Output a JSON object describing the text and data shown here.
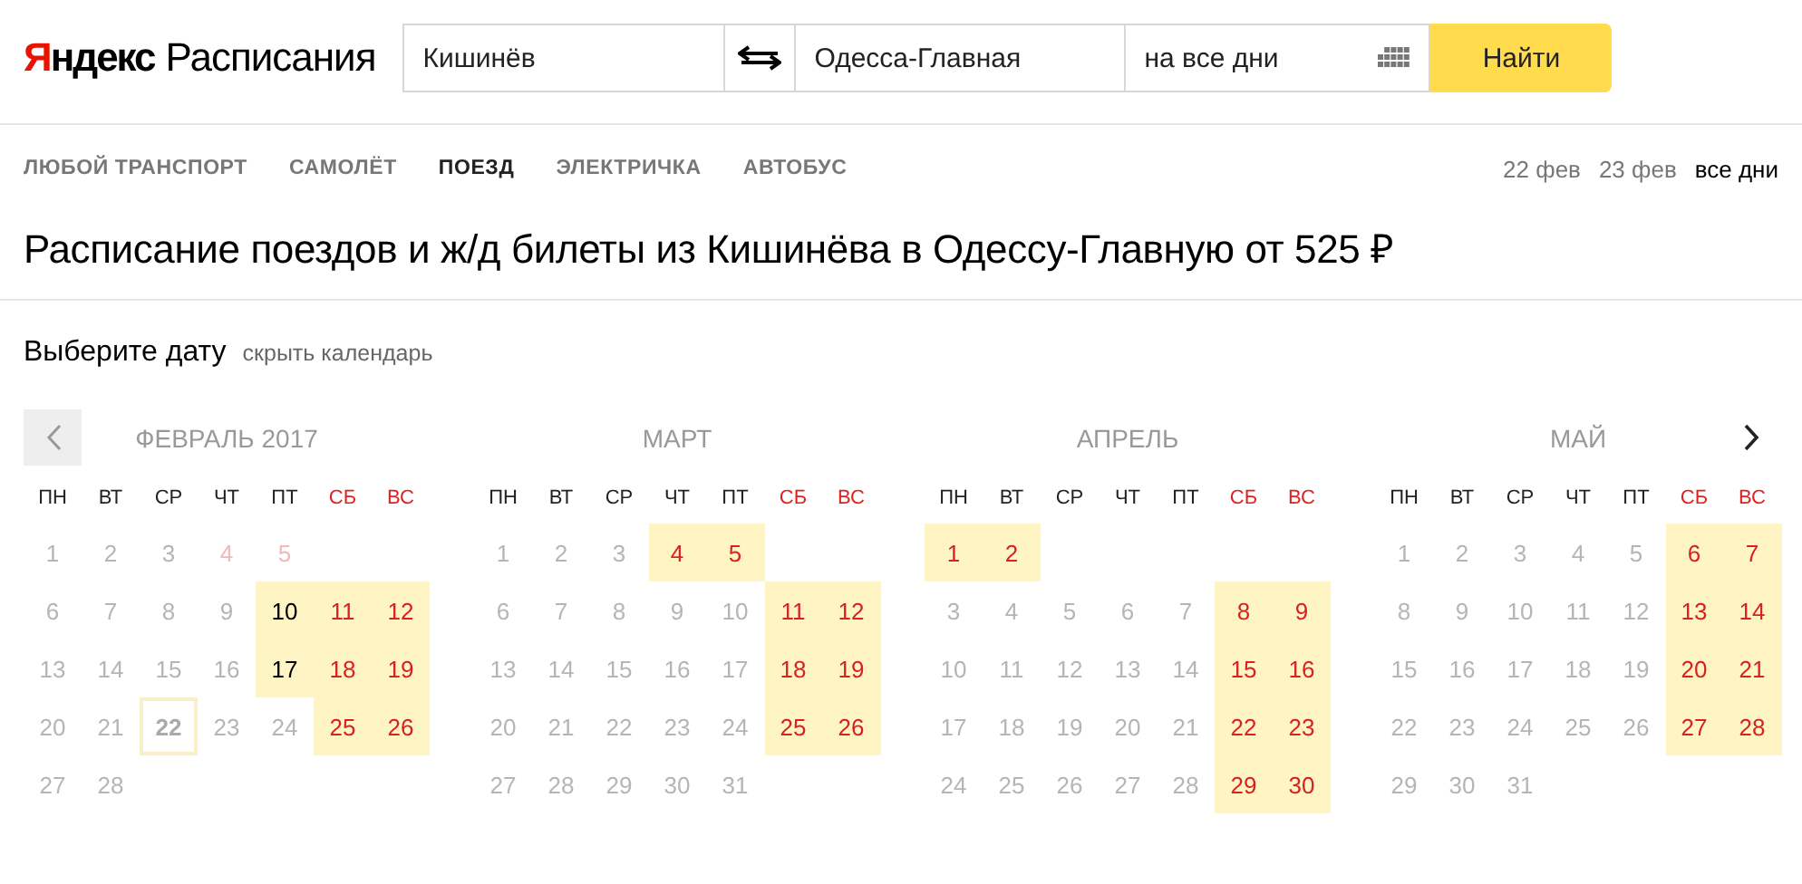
{
  "logo": {
    "brand": "Яндекс",
    "product": "Расписания"
  },
  "search": {
    "from": "Кишинёв",
    "to": "Одесса-Главная",
    "date": "на все дни",
    "submit": "Найти"
  },
  "transport_tabs": [
    {
      "label": "ЛЮБОЙ ТРАНСПОРТ",
      "selected": false
    },
    {
      "label": "САМОЛЁТ",
      "selected": false
    },
    {
      "label": "ПОЕЗД",
      "selected": true
    },
    {
      "label": "ЭЛЕКТРИЧКА",
      "selected": false
    },
    {
      "label": "АВТОБУС",
      "selected": false
    }
  ],
  "date_links": [
    {
      "label": "22 фев",
      "selected": false
    },
    {
      "label": "23 фев",
      "selected": false
    },
    {
      "label": "все дни",
      "selected": true
    }
  ],
  "heading": "Расписание поездов и ж/д билеты из Кишинёва в Одессу-Главную от 525 ₽",
  "calendar": {
    "title": "Выберите дату",
    "hide_link": "скрыть календарь",
    "months": [
      {
        "title": "ФЕВРАЛЬ 2017",
        "weekdays": [
          {
            "label": "ПН",
            "weekend": false
          },
          {
            "label": "ВТ",
            "weekend": false
          },
          {
            "label": "СР",
            "weekend": false
          },
          {
            "label": "ЧТ",
            "weekend": false
          },
          {
            "label": "ПТ",
            "weekend": false
          },
          {
            "label": "СБ",
            "weekend": true
          },
          {
            "label": "ВС",
            "weekend": true
          }
        ],
        "weeks": [
          [
            {
              "day": "1",
              "available": false,
              "today": false
            },
            {
              "day": "2",
              "available": false,
              "today": false
            },
            {
              "day": "3",
              "available": false,
              "today": false
            },
            {
              "day": "4",
              "available": false,
              "today": false
            },
            {
              "day": "5",
              "available": false,
              "today": false
            }
          ],
          [
            {
              "day": "6",
              "available": false,
              "today": false
            },
            {
              "day": "7",
              "available": false,
              "today": false
            },
            {
              "day": "8",
              "available": false,
              "today": false
            },
            {
              "day": "9",
              "available": false,
              "today": false
            },
            {
              "day": "10",
              "available": true,
              "today": false
            },
            {
              "day": "11",
              "available": true,
              "today": false
            },
            {
              "day": "12",
              "available": true,
              "today": false
            }
          ],
          [
            {
              "day": "13",
              "available": false,
              "today": false
            },
            {
              "day": "14",
              "available": false,
              "today": false
            },
            {
              "day": "15",
              "available": false,
              "today": false
            },
            {
              "day": "16",
              "available": false,
              "today": false
            },
            {
              "day": "17",
              "available": true,
              "today": false
            },
            {
              "day": "18",
              "available": true,
              "today": false
            },
            {
              "day": "19",
              "available": true,
              "today": false
            }
          ],
          [
            {
              "day": "20",
              "available": false,
              "today": false
            },
            {
              "day": "21",
              "available": false,
              "today": false
            },
            {
              "day": "22",
              "available": false,
              "today": true
            },
            {
              "day": "23",
              "available": false,
              "today": false
            },
            {
              "day": "24",
              "available": false,
              "today": false
            },
            {
              "day": "25",
              "available": true,
              "today": false
            },
            {
              "day": "26",
              "available": true,
              "today": false
            }
          ],
          [
            {
              "day": "27",
              "available": false,
              "today": false
            },
            {
              "day": "28",
              "available": false,
              "today": false
            }
          ]
        ]
      },
      {
        "title": "МАРТ",
        "weekdays": [
          {
            "label": "ПН",
            "weekend": false
          },
          {
            "label": "ВТ",
            "weekend": false
          },
          {
            "label": "СР",
            "weekend": false
          },
          {
            "label": "ЧТ",
            "weekend": false
          },
          {
            "label": "ПТ",
            "weekend": false
          },
          {
            "label": "СБ",
            "weekend": true
          },
          {
            "label": "ВС",
            "weekend": true
          }
        ],
        "weeks": [
          [
            {
              "day": "1",
              "available": false,
              "today": false
            },
            {
              "day": "2",
              "available": false,
              "today": false
            },
            {
              "day": "3",
              "available": false,
              "today": false
            },
            {
              "day": "4",
              "available": true,
              "today": false
            },
            {
              "day": "5",
              "available": true,
              "today": false
            }
          ],
          [
            {
              "day": "6",
              "available": false,
              "today": false
            },
            {
              "day": "7",
              "available": false,
              "today": false
            },
            {
              "day": "8",
              "available": false,
              "today": false
            },
            {
              "day": "9",
              "available": false,
              "today": false
            },
            {
              "day": "10",
              "available": false,
              "today": false
            },
            {
              "day": "11",
              "available": true,
              "today": false
            },
            {
              "day": "12",
              "available": true,
              "today": false
            }
          ],
          [
            {
              "day": "13",
              "available": false,
              "today": false
            },
            {
              "day": "14",
              "available": false,
              "today": false
            },
            {
              "day": "15",
              "available": false,
              "today": false
            },
            {
              "day": "16",
              "available": false,
              "today": false
            },
            {
              "day": "17",
              "available": false,
              "today": false
            },
            {
              "day": "18",
              "available": true,
              "today": false
            },
            {
              "day": "19",
              "available": true,
              "today": false
            }
          ],
          [
            {
              "day": "20",
              "available": false,
              "today": false
            },
            {
              "day": "21",
              "available": false,
              "today": false
            },
            {
              "day": "22",
              "available": false,
              "today": false
            },
            {
              "day": "23",
              "available": false,
              "today": false
            },
            {
              "day": "24",
              "available": false,
              "today": false
            },
            {
              "day": "25",
              "available": true,
              "today": false
            },
            {
              "day": "26",
              "available": true,
              "today": false
            }
          ],
          [
            {
              "day": "27",
              "available": false,
              "today": false
            },
            {
              "day": "28",
              "available": false,
              "today": false
            },
            {
              "day": "29",
              "available": false,
              "today": false
            },
            {
              "day": "30",
              "available": false,
              "today": false
            },
            {
              "day": "31",
              "available": false,
              "today": false
            }
          ]
        ]
      },
      {
        "title": "АПРЕЛЬ",
        "weekdays": [
          {
            "label": "ПН",
            "weekend": false
          },
          {
            "label": "ВТ",
            "weekend": false
          },
          {
            "label": "СР",
            "weekend": false
          },
          {
            "label": "ЧТ",
            "weekend": false
          },
          {
            "label": "ПТ",
            "weekend": false
          },
          {
            "label": "СБ",
            "weekend": true
          },
          {
            "label": "ВС",
            "weekend": true
          }
        ],
        "weeks": [
          [
            {
              "day": "1",
              "available": true,
              "today": false
            },
            {
              "day": "2",
              "available": true,
              "today": false
            }
          ],
          [
            {
              "day": "3",
              "available": false,
              "today": false
            },
            {
              "day": "4",
              "available": false,
              "today": false
            },
            {
              "day": "5",
              "available": false,
              "today": false
            },
            {
              "day": "6",
              "available": false,
              "today": false
            },
            {
              "day": "7",
              "available": false,
              "today": false
            },
            {
              "day": "8",
              "available": true,
              "today": false
            },
            {
              "day": "9",
              "available": true,
              "today": false
            }
          ],
          [
            {
              "day": "10",
              "available": false,
              "today": false
            },
            {
              "day": "11",
              "available": false,
              "today": false
            },
            {
              "day": "12",
              "available": false,
              "today": false
            },
            {
              "day": "13",
              "available": false,
              "today": false
            },
            {
              "day": "14",
              "available": false,
              "today": false
            },
            {
              "day": "15",
              "available": true,
              "today": false
            },
            {
              "day": "16",
              "available": true,
              "today": false
            }
          ],
          [
            {
              "day": "17",
              "available": false,
              "today": false
            },
            {
              "day": "18",
              "available": false,
              "today": false
            },
            {
              "day": "19",
              "available": false,
              "today": false
            },
            {
              "day": "20",
              "available": false,
              "today": false
            },
            {
              "day": "21",
              "available": false,
              "today": false
            },
            {
              "day": "22",
              "available": true,
              "today": false
            },
            {
              "day": "23",
              "available": true,
              "today": false
            }
          ],
          [
            {
              "day": "24",
              "available": false,
              "today": false
            },
            {
              "day": "25",
              "available": false,
              "today": false
            },
            {
              "day": "26",
              "available": false,
              "today": false
            },
            {
              "day": "27",
              "available": false,
              "today": false
            },
            {
              "day": "28",
              "available": false,
              "today": false
            },
            {
              "day": "29",
              "available": true,
              "today": false
            },
            {
              "day": "30",
              "available": true,
              "today": false
            }
          ]
        ]
      },
      {
        "title": "МАЙ",
        "weekdays": [
          {
            "label": "ПН",
            "weekend": false
          },
          {
            "label": "ВТ",
            "weekend": false
          },
          {
            "label": "СР",
            "weekend": false
          },
          {
            "label": "ЧТ",
            "weekend": false
          },
          {
            "label": "ПТ",
            "weekend": false
          },
          {
            "label": "СБ",
            "weekend": true
          },
          {
            "label": "ВС",
            "weekend": true
          }
        ],
        "weeks": [
          [
            {
              "day": "1",
              "available": false,
              "today": false
            },
            {
              "day": "2",
              "available": false,
              "today": false
            },
            {
              "day": "3",
              "available": false,
              "today": false
            },
            {
              "day": "4",
              "available": false,
              "today": false
            },
            {
              "day": "5",
              "available": false,
              "today": false
            },
            {
              "day": "6",
              "available": true,
              "today": false
            },
            {
              "day": "7",
              "available": true,
              "today": false
            }
          ],
          [
            {
              "day": "8",
              "available": false,
              "today": false
            },
            {
              "day": "9",
              "available": false,
              "today": false
            },
            {
              "day": "10",
              "available": false,
              "today": false
            },
            {
              "day": "11",
              "available": false,
              "today": false
            },
            {
              "day": "12",
              "available": false,
              "today": false
            },
            {
              "day": "13",
              "available": true,
              "today": false
            },
            {
              "day": "14",
              "available": true,
              "today": false
            }
          ],
          [
            {
              "day": "15",
              "available": false,
              "today": false
            },
            {
              "day": "16",
              "available": false,
              "today": false
            },
            {
              "day": "17",
              "available": false,
              "today": false
            },
            {
              "day": "18",
              "available": false,
              "today": false
            },
            {
              "day": "19",
              "available": false,
              "today": false
            },
            {
              "day": "20",
              "available": true,
              "today": false
            },
            {
              "day": "21",
              "available": true,
              "today": false
            }
          ],
          [
            {
              "day": "22",
              "available": false,
              "today": false
            },
            {
              "day": "23",
              "available": false,
              "today": false
            },
            {
              "day": "24",
              "available": false,
              "today": false
            },
            {
              "day": "25",
              "available": false,
              "today": false
            },
            {
              "day": "26",
              "available": false,
              "today": false
            },
            {
              "day": "27",
              "available": true,
              "today": false
            },
            {
              "day": "28",
              "available": true,
              "today": false
            }
          ],
          [
            {
              "day": "29",
              "available": false,
              "today": false
            },
            {
              "day": "30",
              "available": false,
              "today": false
            },
            {
              "day": "31",
              "available": false,
              "today": false
            }
          ]
        ]
      }
    ]
  }
}
